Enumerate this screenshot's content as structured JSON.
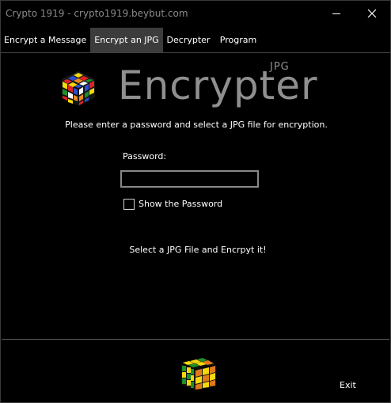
{
  "window": {
    "title": "Crypto 1919 - crypto1919.beybut.com",
    "minimize_icon": "minimize-icon",
    "close_icon": "close-icon"
  },
  "tabs": [
    {
      "label": "Encrypt a Message",
      "selected": false
    },
    {
      "label": "Encrypt an JPG",
      "selected": true
    },
    {
      "label": "Decrypter",
      "selected": false
    },
    {
      "label": "Program",
      "selected": false
    }
  ],
  "main": {
    "logo_icon": "rubiks-cube-icon",
    "brand_title": "Encrypter",
    "brand_subtitle": "JPG",
    "instruction": "Please enter a password and select a JPG file for encryption.",
    "password_label": "Password:",
    "password_value": "",
    "show_password_label": "Show the Password",
    "show_password_checked": false,
    "select_file_label": "Select a JPG File and Encrpyt it!"
  },
  "footer": {
    "cube_icon": "rubiks-cube-icon",
    "exit_label": "Exit"
  },
  "colors": {
    "background": "#000000",
    "selected_tab": "#3c3c3c",
    "brand_text": "#8f8f8f",
    "title_text": "#8a8a8a"
  }
}
